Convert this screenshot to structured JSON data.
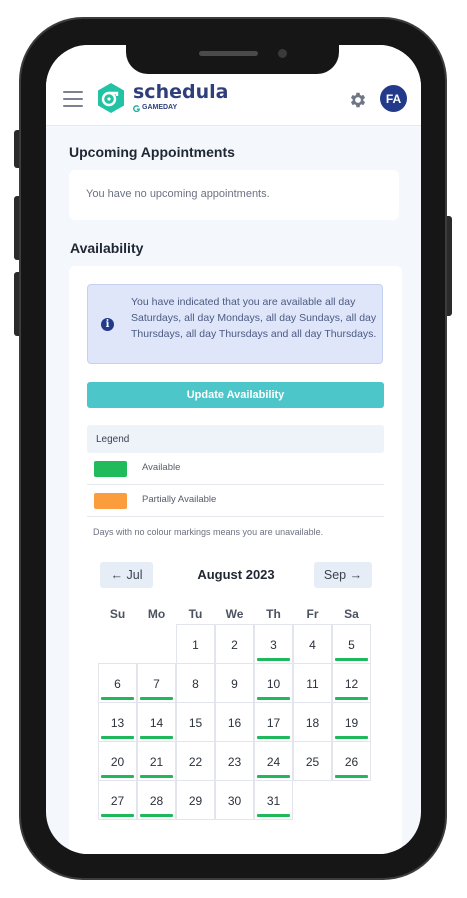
{
  "app": {
    "brand_name": "schedula",
    "brand_sub": "GAMEDAY",
    "avatar_initials": "FA"
  },
  "upcoming": {
    "title": "Upcoming Appointments",
    "empty_text": "You have no upcoming appointments."
  },
  "availability": {
    "title": "Availability",
    "info_text": "You have indicated that you are available all day Saturdays, all day Mondays, all day Sundays, all day Thursdays, all day Thursdays and all day Thursdays.",
    "update_button": "Update Availability",
    "legend": {
      "title": "Legend",
      "items": [
        {
          "label": "Available",
          "color": "#22bb5b"
        },
        {
          "label": "Partially Available",
          "color": "#fb9d3c"
        }
      ]
    },
    "note": "Days with no colour markings means you are unavailable."
  },
  "calendar": {
    "prev_label": "← Jul",
    "next_label": "Sep →",
    "month_title": "August 2023",
    "weekdays": [
      "Su",
      "Mo",
      "Tu",
      "We",
      "Th",
      "Fr",
      "Sa"
    ],
    "first_weekday_index": 2,
    "days": [
      {
        "n": "1",
        "available": false
      },
      {
        "n": "2",
        "available": false
      },
      {
        "n": "3",
        "available": true
      },
      {
        "n": "4",
        "available": false
      },
      {
        "n": "5",
        "available": true
      },
      {
        "n": "6",
        "available": true
      },
      {
        "n": "7",
        "available": true
      },
      {
        "n": "8",
        "available": false
      },
      {
        "n": "9",
        "available": false
      },
      {
        "n": "10",
        "available": true
      },
      {
        "n": "11",
        "available": false
      },
      {
        "n": "12",
        "available": true
      },
      {
        "n": "13",
        "available": true
      },
      {
        "n": "14",
        "available": true
      },
      {
        "n": "15",
        "available": false
      },
      {
        "n": "16",
        "available": false
      },
      {
        "n": "17",
        "available": true
      },
      {
        "n": "18",
        "available": false
      },
      {
        "n": "19",
        "available": true
      },
      {
        "n": "20",
        "available": true
      },
      {
        "n": "21",
        "available": true
      },
      {
        "n": "22",
        "available": false
      },
      {
        "n": "23",
        "available": false
      },
      {
        "n": "24",
        "available": true
      },
      {
        "n": "25",
        "available": false
      },
      {
        "n": "26",
        "available": true
      },
      {
        "n": "27",
        "available": true
      },
      {
        "n": "28",
        "available": true
      },
      {
        "n": "29",
        "available": false
      },
      {
        "n": "30",
        "available": false
      },
      {
        "n": "31",
        "available": true
      }
    ]
  },
  "colors": {
    "accent_teal": "#4cc6c9",
    "brand_navy": "#23398a",
    "available_green": "#1fb85a"
  }
}
